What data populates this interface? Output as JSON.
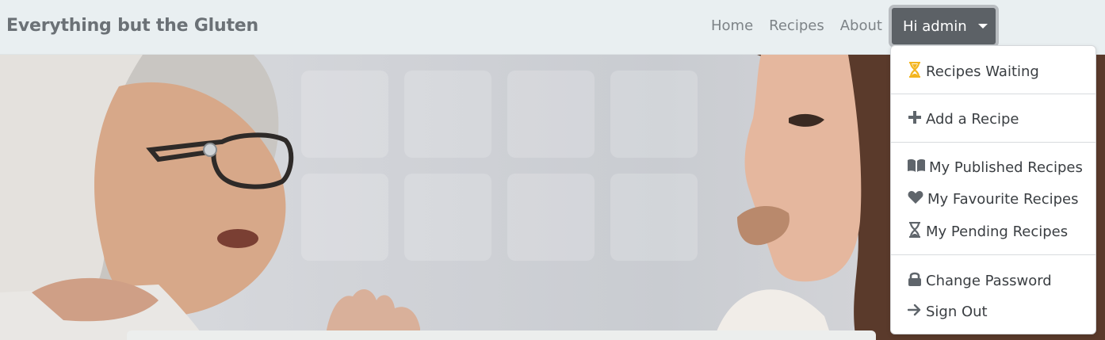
{
  "brand": "Everything but the Gluten",
  "nav": {
    "links": [
      "Home",
      "Recipes",
      "About"
    ],
    "user_button": "Hi admin"
  },
  "dropdown": {
    "items": [
      {
        "label": "Recipes Waiting",
        "icon": "hourglass-icon"
      },
      {
        "label": "Add a Recipe",
        "icon": "plus-icon"
      },
      {
        "label": "My Published Recipes",
        "icon": "book-open-icon"
      },
      {
        "label": "My Favourite Recipes",
        "icon": "heart-icon"
      },
      {
        "label": "My Pending Recipes",
        "icon": "hourglass-icon"
      },
      {
        "label": "Change Password",
        "icon": "lock-icon"
      },
      {
        "label": "Sign Out",
        "icon": "arrow-right-icon"
      }
    ]
  },
  "colors": {
    "navbar_bg": "#e9eff1",
    "user_button_bg": "#5c6166",
    "hourglass_accent": "#f3b51f",
    "icon_gray": "#5f656b"
  }
}
